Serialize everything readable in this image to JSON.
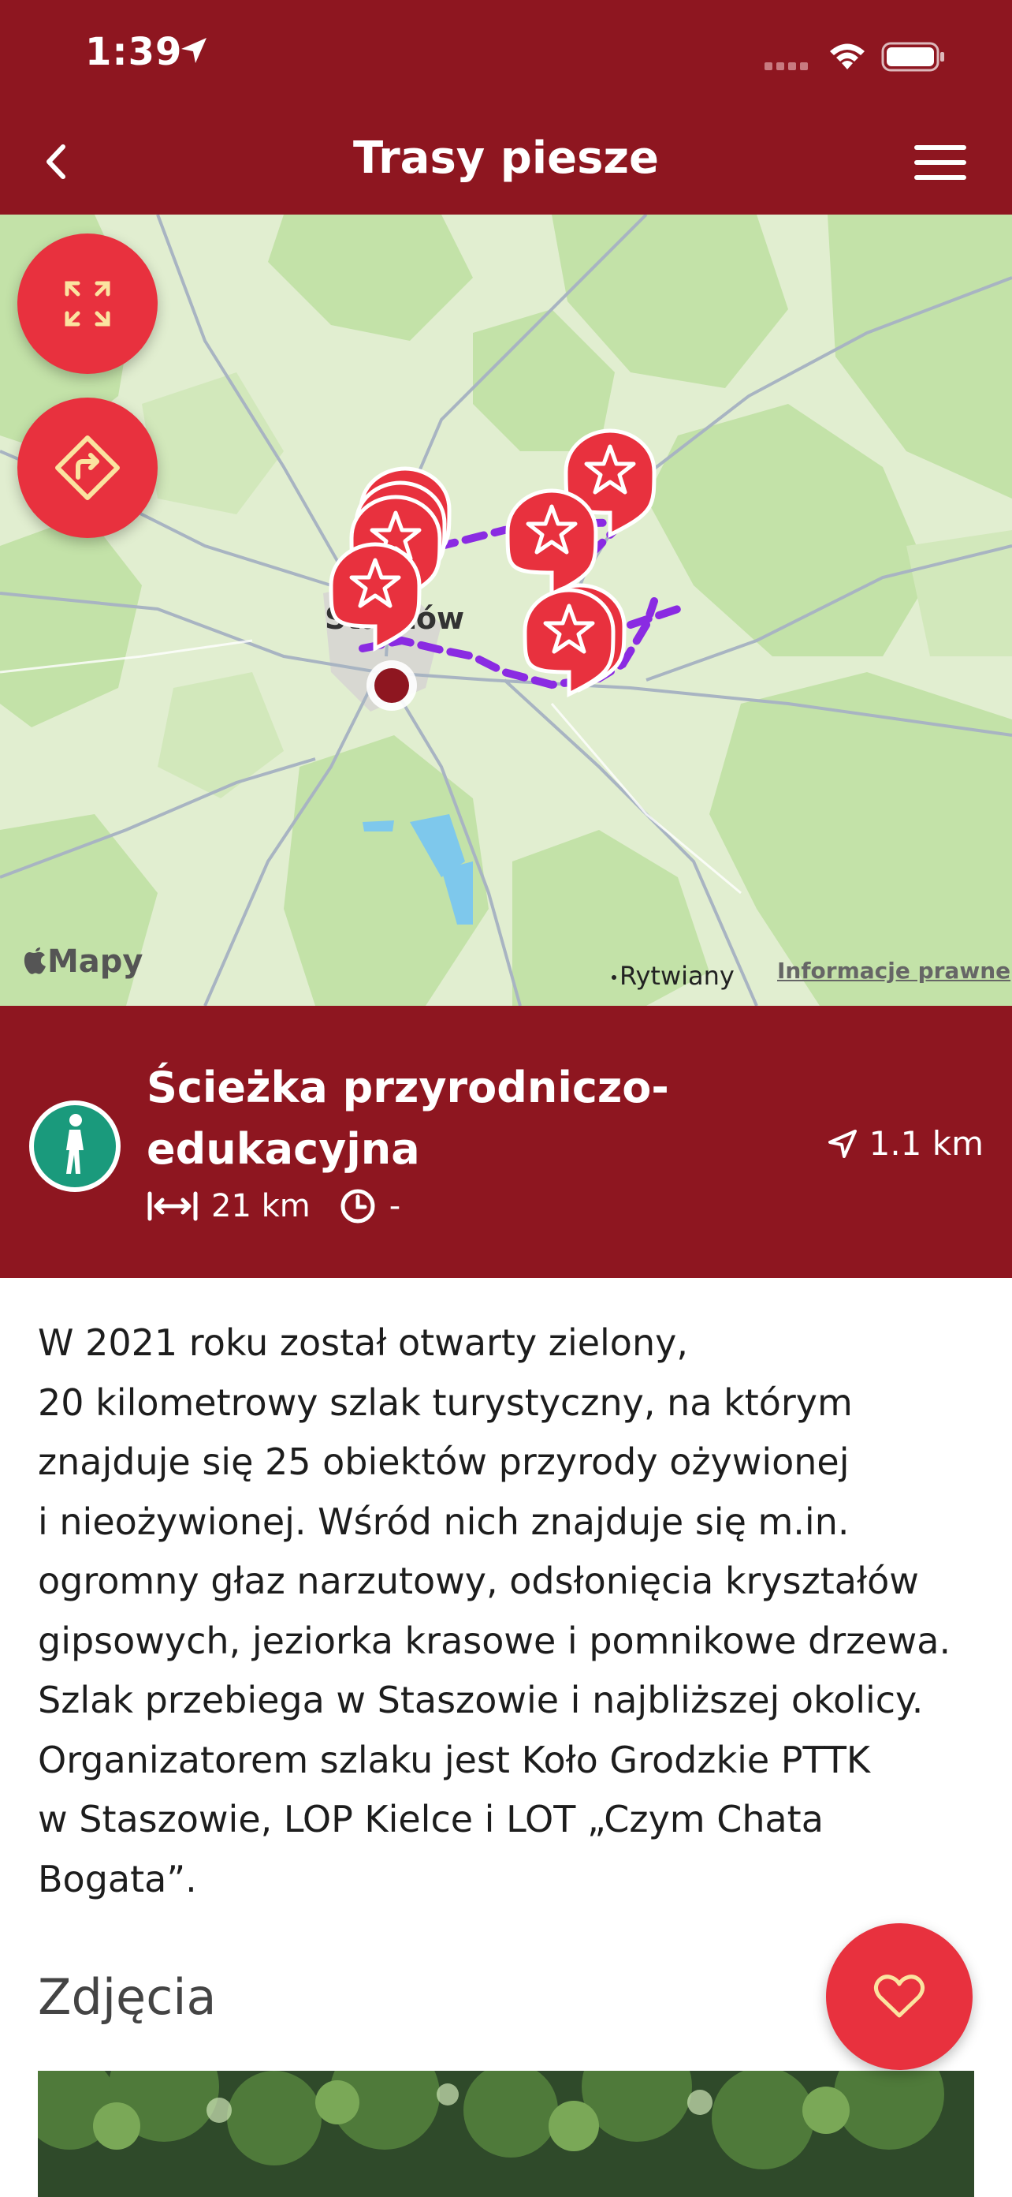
{
  "status_bar": {
    "time": "1:39"
  },
  "header": {
    "title": "Trasy piesze",
    "back_icon": "chevron-left-icon",
    "menu_icon": "hamburger-menu-icon"
  },
  "map": {
    "place_labels": [
      "Staszów",
      "Rytwiany"
    ],
    "attribution": "Mapy",
    "legal_link": "Informacje prawne",
    "route_color": "#8a2be2",
    "pin_color": "#e8313e"
  },
  "route": {
    "title": "Ścieżka  przyrodniczo-edukacyjna",
    "length": "21 km",
    "duration": "-",
    "distance_from_user": "1.1 km"
  },
  "description": "W 2021 roku został otwarty zielony,\n20 kilometrowy szlak turystyczny, na którym\nznajduje się 25 obiektów przyrody ożywionej\ni nieożywionej. Wśród nich znajduje się m.in.\nogromny głaz narzutowy, odsłonięcia kryształów\ngipsowych, jeziorka krasowe i pomnikowe drzewa.\nSzlak przebiega w Staszowie i najbliższej okolicy.\nOrganizatorem szlaku jest Koło Grodzkie PTTK\nw Staszowie, LOP Kielce i LOT „Czym Chata\nBogata”.",
  "photos_section": {
    "title": "Zdjęcia"
  },
  "colors": {
    "brand": "#8e1620",
    "accent": "#e8313e"
  }
}
